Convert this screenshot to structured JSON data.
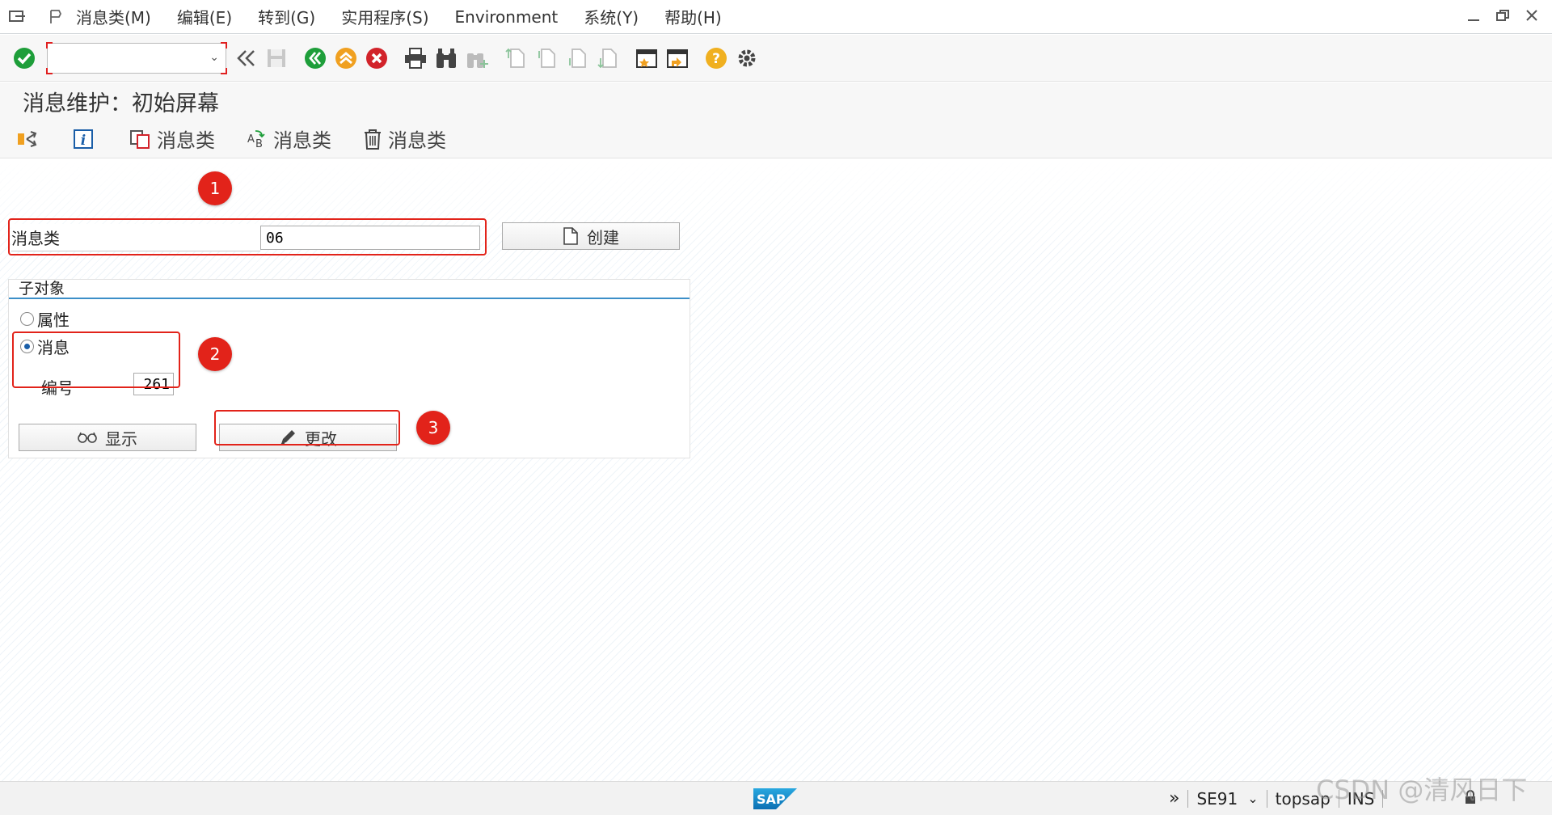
{
  "menubar": {
    "items": [
      "消息类(M)",
      "编辑(E)",
      "转到(G)",
      "实用程序(S)",
      "Environment",
      "系统(Y)",
      "帮助(H)"
    ]
  },
  "toolbar": {
    "command_value": "",
    "icons": [
      "check-icon",
      "back-double-icon",
      "save-icon",
      "back-icon",
      "exit-icon",
      "cancel-icon",
      "print-icon",
      "find-icon",
      "find-next-icon",
      "first-page-icon",
      "prev-page-icon",
      "next-page-icon",
      "last-page-icon",
      "new-session-icon",
      "shortcut-icon",
      "help-icon",
      "settings-icon"
    ]
  },
  "title": "消息维护：初始屏幕",
  "app_toolbar": {
    "copy_label": "消息类",
    "rename_label": "消息类",
    "delete_label": "消息类"
  },
  "form": {
    "message_class_label": "消息类",
    "message_class_value": "06",
    "create_label": "创建",
    "group_title": "子对象",
    "radio_attributes": "属性",
    "radio_messages": "消息",
    "number_label": "编号",
    "number_value": "261",
    "display_label": "显示",
    "change_label": "更改"
  },
  "callouts": [
    "1",
    "2",
    "3"
  ],
  "statusbar": {
    "tcode": "SE91",
    "server": "topsap",
    "mode": "INS"
  },
  "watermark": "CSDN @清风日下",
  "colors": {
    "accent_red": "#e2231a",
    "group_line": "#3c8fc8",
    "green": "#1e9e3a",
    "orange": "#f0a020"
  }
}
